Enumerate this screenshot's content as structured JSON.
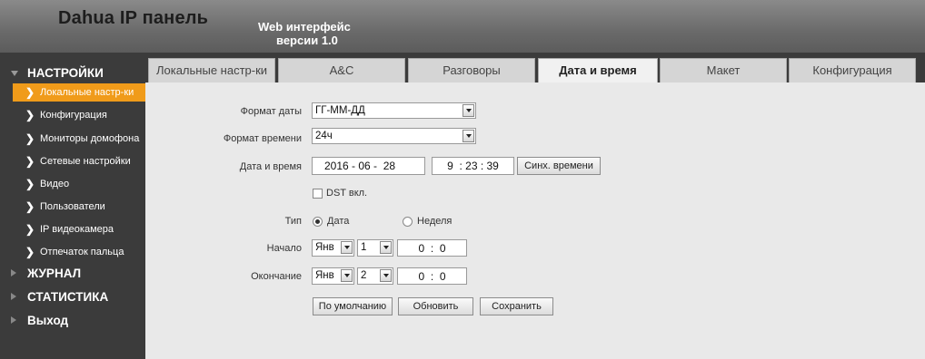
{
  "header": {
    "brand": "Dahua IP панель",
    "version_line1": "Web интерфейс",
    "version_line2": "версии 1.0"
  },
  "sidebar": {
    "groups": [
      {
        "label": "НАСТРОЙКИ"
      },
      {
        "label": "ЖУРНАЛ"
      },
      {
        "label": "СТАТИСТИКА"
      },
      {
        "label": "Выход"
      }
    ],
    "items": [
      {
        "label": "Локальные настр-ки",
        "active": true
      },
      {
        "label": "Конфигурация"
      },
      {
        "label": "Мониторы домофона"
      },
      {
        "label": "Сетевые настройки"
      },
      {
        "label": "Видео"
      },
      {
        "label": "Пользователи"
      },
      {
        "label": "IP видеокамера"
      },
      {
        "label": "Отпечаток пальца"
      }
    ],
    "active_color": "#f09b1a"
  },
  "tabs": [
    {
      "label": "Локальные настр-ки"
    },
    {
      "label": "А&С"
    },
    {
      "label": "Разговоры"
    },
    {
      "label": "Дата и время",
      "active": true
    },
    {
      "label": "Макет"
    },
    {
      "label": "Конфигурация"
    }
  ],
  "form": {
    "date_format": {
      "label": "Формат даты",
      "value": "ГГ-ММ-ДД"
    },
    "time_format": {
      "label": "Формат времени",
      "value": "24ч"
    },
    "datetime": {
      "label": "Дата и время",
      "date": "2016 - 06 -  28",
      "time": "9  : 23 : 39",
      "sync_button": "Синх. времени"
    },
    "dst": {
      "label": "DST вкл.",
      "checked": false
    },
    "type": {
      "label": "Тип",
      "option_date": "Дата",
      "option_week": "Неделя",
      "selected": "Дата"
    },
    "start": {
      "label": "Начало",
      "month": "Янв",
      "day": "1",
      "time": "0  :  0"
    },
    "end": {
      "label": "Окончание",
      "month": "Янв",
      "day": "2",
      "time": "0  :  0"
    },
    "buttons": {
      "default": "По умолчанию",
      "refresh": "Обновить",
      "save": "Сохранить"
    }
  }
}
